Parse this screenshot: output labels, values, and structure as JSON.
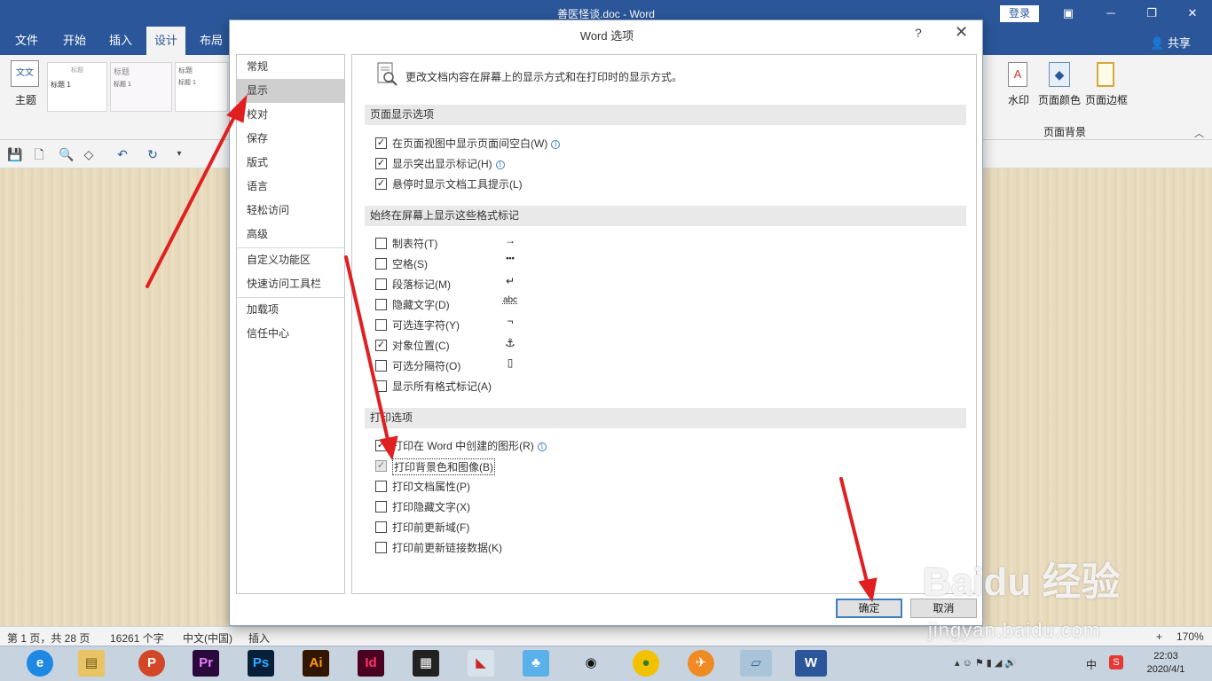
{
  "window": {
    "title": "善医怪谈.doc  -  Word",
    "login": "登录",
    "share": "共享"
  },
  "ribbon_tabs": [
    "文件",
    "开始",
    "插入",
    "设计",
    "布局"
  ],
  "ribbon": {
    "theme_label": "主题",
    "theme_icon_text": "文文",
    "thumbs": [
      {
        "title": "标题",
        "heading": "标题 1"
      },
      {
        "title": "标题",
        "heading": "标题 1"
      },
      {
        "title": "标题",
        "heading": "标题 1"
      }
    ],
    "watermark_label": "水印",
    "page_color_label": "页面颜色",
    "page_border_label": "页面边框",
    "group_label": "页面背景"
  },
  "dialog": {
    "title": "Word 选项",
    "help": "?",
    "close": "✕",
    "nav_items": [
      "常规",
      "显示",
      "校对",
      "保存",
      "版式",
      "语言",
      "轻松访问",
      "高级",
      "自定义功能区",
      "快速访问工具栏",
      "加载项",
      "信任中心"
    ],
    "active_nav": "显示",
    "intro": "更改文档内容在屏幕上的显示方式和在打印时的显示方式。",
    "sections": {
      "page_display": {
        "heading": "页面显示选项",
        "options": [
          {
            "label": "在页面视图中显示页面间空白(W)",
            "checked": true,
            "info": true
          },
          {
            "label": "显示突出显示标记(H)",
            "checked": true,
            "info": true
          },
          {
            "label": "悬停时显示文档工具提示(L)",
            "checked": true,
            "info": false
          }
        ]
      },
      "format_marks": {
        "heading": "始终在屏幕上显示这些格式标记",
        "options": [
          {
            "label": "制表符(T)",
            "checked": false,
            "symbol": "→"
          },
          {
            "label": "空格(S)",
            "checked": false,
            "symbol": "•••"
          },
          {
            "label": "段落标记(M)",
            "checked": false,
            "symbol": "↵"
          },
          {
            "label": "隐藏文字(D)",
            "checked": false,
            "symbol": "abc"
          },
          {
            "label": "可选连字符(Y)",
            "checked": false,
            "symbol": "¬"
          },
          {
            "label": "对象位置(C)",
            "checked": true,
            "symbol": "⚓"
          },
          {
            "label": "可选分隔符(O)",
            "checked": false,
            "symbol": "▯"
          },
          {
            "label": "显示所有格式标记(A)",
            "checked": false,
            "symbol": ""
          }
        ]
      },
      "print": {
        "heading": "打印选项",
        "options": [
          {
            "label": "打印在 Word 中创建的图形(R)",
            "checked": true,
            "info": true
          },
          {
            "label": "打印背景色和图像(B)",
            "checked": true,
            "info": false
          },
          {
            "label": "打印文档属性(P)",
            "checked": false,
            "info": false
          },
          {
            "label": "打印隐藏文字(X)",
            "checked": false,
            "info": false
          },
          {
            "label": "打印前更新域(F)",
            "checked": false,
            "info": false
          },
          {
            "label": "打印前更新链接数据(K)",
            "checked": false,
            "info": false
          }
        ]
      }
    },
    "ok_label": "确定",
    "cancel_label": "取消"
  },
  "status": {
    "page": "第 1 页，共 28 页",
    "words": "16261 个字",
    "lang": "中文(中国)",
    "mode": "插入",
    "zoom": "170%"
  },
  "taskbar": {
    "apps": [
      "Pr",
      "Ps",
      "Ai",
      "Id"
    ],
    "ime": "中",
    "time": "22:03",
    "date": "2020/4/1"
  },
  "watermark": {
    "brand": "Baidu 经验",
    "url": "jingyan.baidu.com"
  },
  "colors": {
    "word_blue": "#2b579a",
    "arrow_red": "#e02020",
    "doc_bg": "#e8dcbf"
  }
}
